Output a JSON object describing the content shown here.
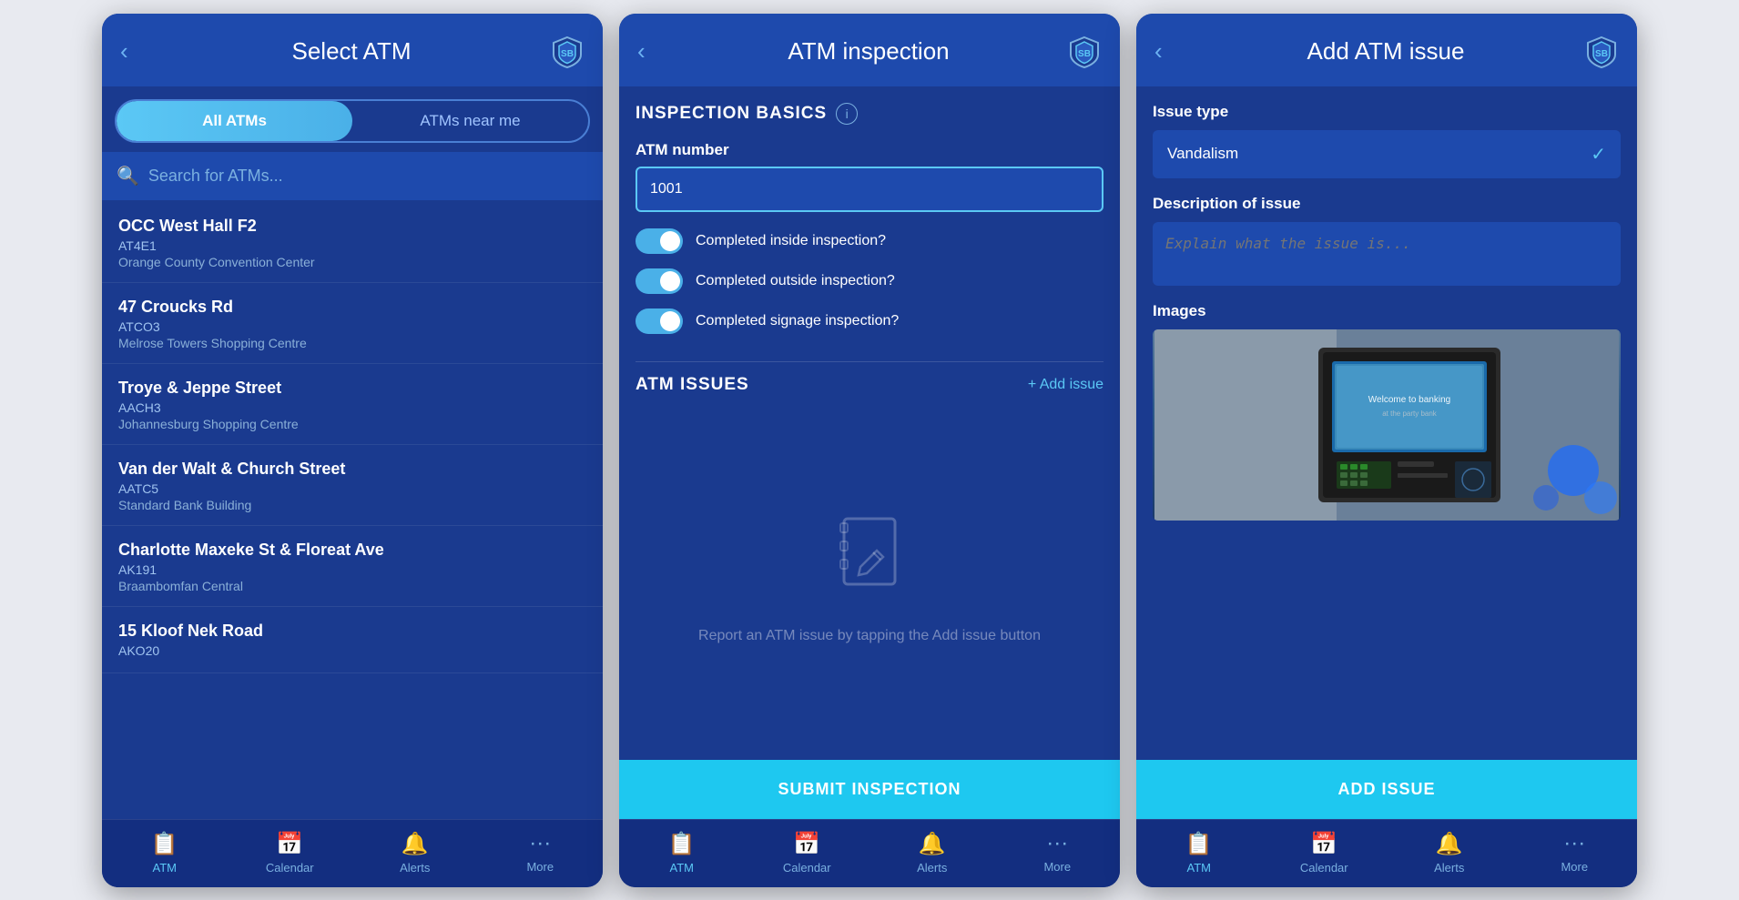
{
  "screen1": {
    "title": "Select ATM",
    "back_label": "‹",
    "tabs": [
      {
        "label": "All ATMs",
        "active": true
      },
      {
        "label": "ATMs near me",
        "active": false
      }
    ],
    "search_placeholder": "Search for ATMs...",
    "atm_list": [
      {
        "name": "OCC West Hall F2",
        "code": "AT4E1",
        "location": "Orange County Convention Center"
      },
      {
        "name": "47 Croucks Rd",
        "code": "ATCO3",
        "location": "Melrose Towers Shopping Centre"
      },
      {
        "name": "Troye & Jeppe Street",
        "code": "AACH3",
        "location": "Johannesburg Shopping Centre"
      },
      {
        "name": "Van der Walt & Church Street",
        "code": "AATC5",
        "location": "Standard Bank Building"
      },
      {
        "name": "Charlotte Maxeke St & Floreat Ave",
        "code": "AK191",
        "location": "Braambomfan Central"
      },
      {
        "name": "15 Kloof Nek Road",
        "code": "AKO20",
        "location": ""
      }
    ],
    "nav": [
      {
        "label": "ATM",
        "icon": "📋",
        "active": true
      },
      {
        "label": "Calendar",
        "icon": "📅",
        "active": false
      },
      {
        "label": "Alerts",
        "icon": "🔔",
        "active": false
      },
      {
        "label": "More",
        "icon": "···",
        "active": false
      }
    ]
  },
  "screen2": {
    "title": "ATM inspection",
    "back_label": "‹",
    "section_title": "INSPECTION BASICS",
    "atm_number_label": "ATM number",
    "atm_number_value": "1001",
    "toggles": [
      {
        "label": "Completed inside inspection?",
        "on": true
      },
      {
        "label": "Completed outside inspection?",
        "on": true
      },
      {
        "label": "Completed signage inspection?",
        "on": true
      }
    ],
    "issues_title": "ATM ISSUES",
    "add_issue_label": "+ Add issue",
    "empty_text": "Report an ATM issue by\ntapping the Add issue button",
    "submit_btn": "SUBMIT INSPECTION",
    "nav": [
      {
        "label": "ATM",
        "icon": "📋",
        "active": true
      },
      {
        "label": "Calendar",
        "icon": "📅",
        "active": false
      },
      {
        "label": "Alerts",
        "icon": "🔔",
        "active": false
      },
      {
        "label": "More",
        "icon": "···",
        "active": false
      }
    ]
  },
  "screen3": {
    "title": "Add ATM issue",
    "back_label": "‹",
    "issue_type_label": "Issue type",
    "issue_type_value": "Vandalism",
    "desc_label": "Description of issue",
    "desc_placeholder": "Explain what the issue is...",
    "images_label": "Images",
    "submit_btn": "ADD ISSUE",
    "atm_bottom_label": "AtM",
    "nav": [
      {
        "label": "ATM",
        "icon": "📋",
        "active": true
      },
      {
        "label": "Calendar",
        "icon": "📅",
        "active": false
      },
      {
        "label": "Alerts",
        "icon": "🔔",
        "active": false
      },
      {
        "label": "More",
        "icon": "···",
        "active": false
      }
    ]
  }
}
